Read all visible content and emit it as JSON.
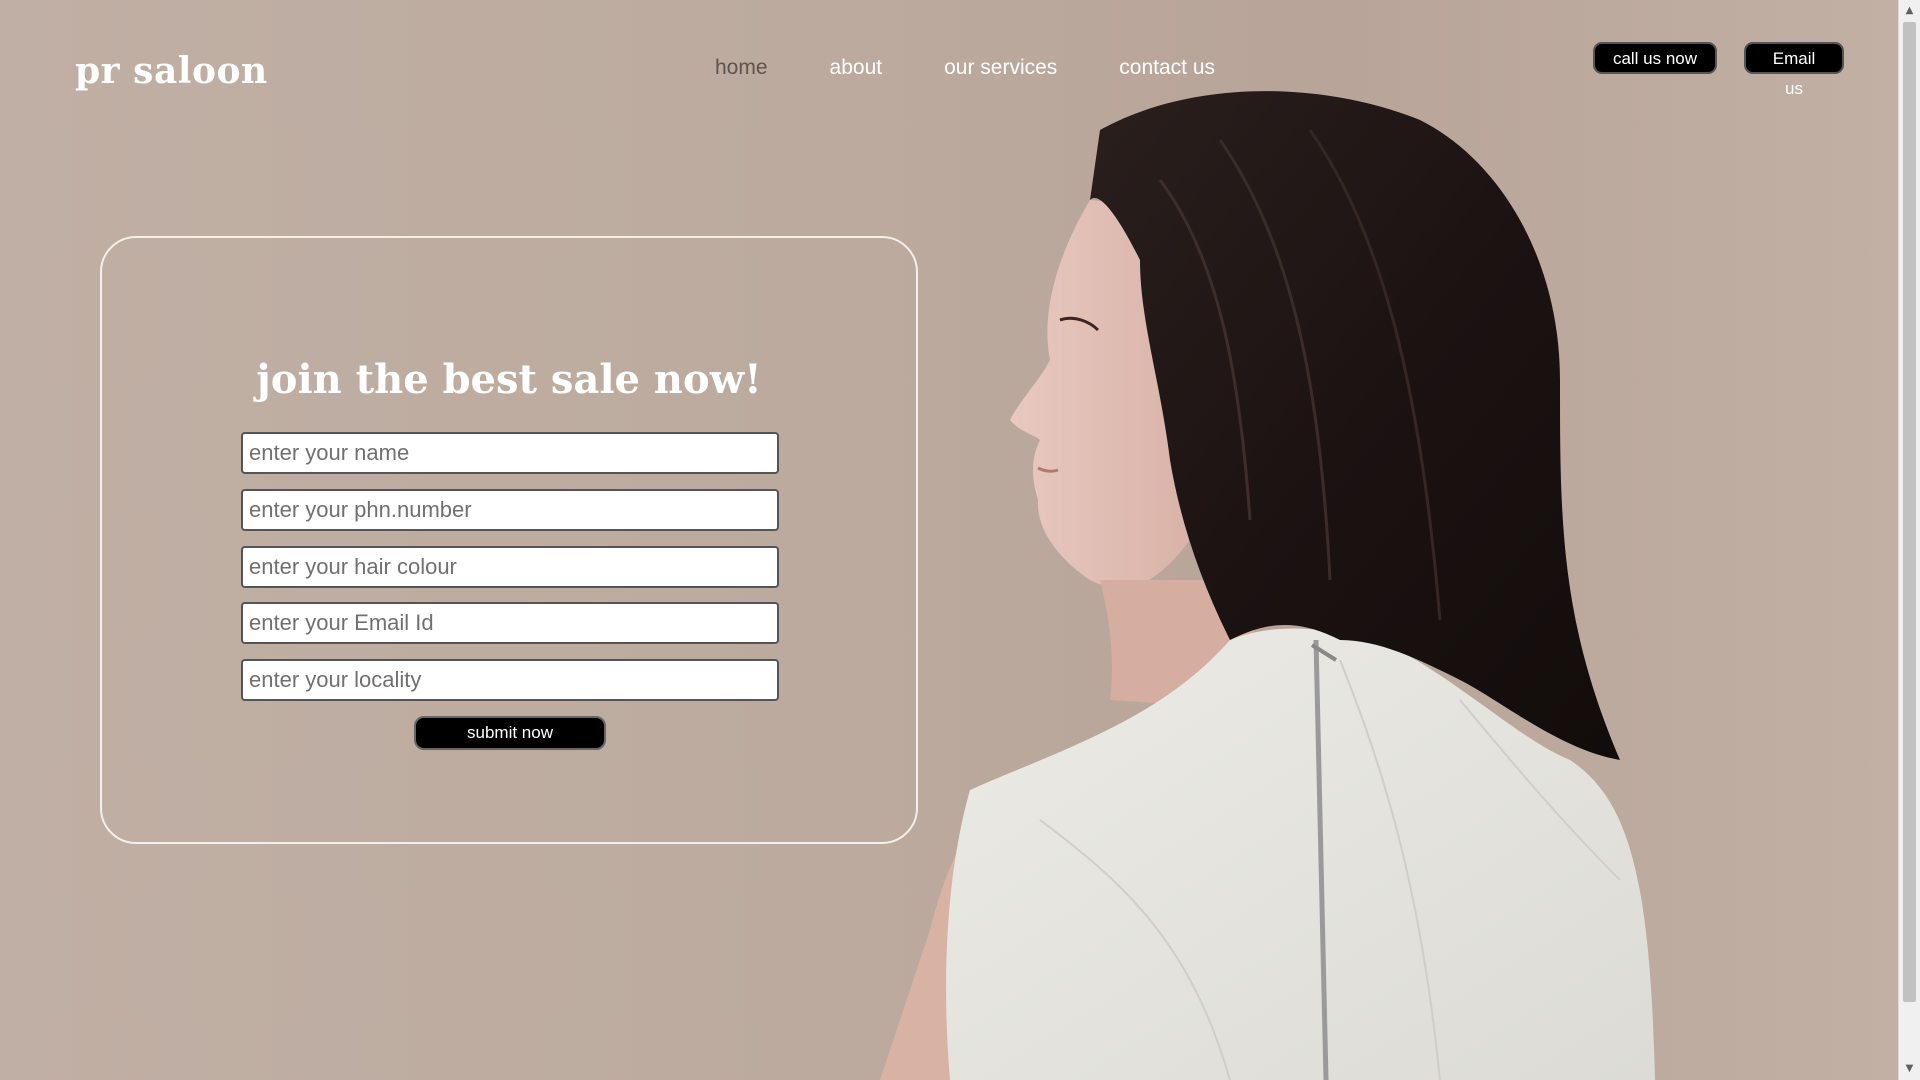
{
  "brand": {
    "name": "pr saloon"
  },
  "nav": {
    "items": [
      {
        "label": "home",
        "active": true
      },
      {
        "label": "about",
        "active": false
      },
      {
        "label": "our services",
        "active": false
      },
      {
        "label": "contact us",
        "active": false
      }
    ]
  },
  "header_actions": {
    "call_label": "call us now",
    "email_label": "Email us"
  },
  "form": {
    "title": "join the best sale now!",
    "fields": [
      {
        "placeholder": "enter your name",
        "value": ""
      },
      {
        "placeholder": "enter your phn.number",
        "value": ""
      },
      {
        "placeholder": "enter your hair colour",
        "value": ""
      },
      {
        "placeholder": "enter your Email Id",
        "value": ""
      },
      {
        "placeholder": "enter your locality",
        "value": ""
      }
    ],
    "submit_label": "submit now"
  },
  "colors": {
    "background": "#bfaea3",
    "button": "#000000",
    "text": "#ffffff",
    "active_nav": "#5c5450"
  },
  "icons": {
    "scroll_up": "scroll-up-arrow-icon",
    "scroll_down": "scroll-down-arrow-icon"
  }
}
